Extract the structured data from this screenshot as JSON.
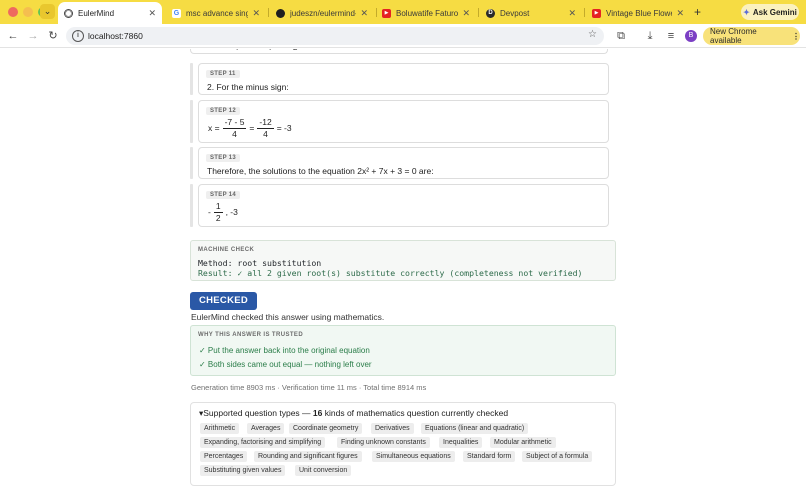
{
  "browser": {
    "tabs": [
      {
        "title": "EulerMind",
        "active": true,
        "icon": "globe-icon"
      },
      {
        "title": "msc advance single",
        "icon": "google-icon"
      },
      {
        "title": "judeszn/eulermind-v",
        "icon": "github-icon"
      },
      {
        "title": "Boluwatife Faturoti",
        "icon": "youtube-icon"
      },
      {
        "title": "Devpost",
        "icon": "devpost-icon"
      },
      {
        "title": "Vintage Blue Flowers",
        "icon": "youtube-icon"
      }
    ],
    "ask_gemini": "Ask Gemini",
    "url": "localhost:7860",
    "profile_initial": "B",
    "update_label": "New Chrome available"
  },
  "steps": [
    {
      "label": "STEP 11",
      "text": "2. For the minus sign:"
    },
    {
      "label": "STEP 12",
      "x_eq": "x =",
      "frac1_num": "-7 - 5",
      "frac1_den": "4",
      "eq2": "=",
      "frac2_num": "-12",
      "frac2_den": "4",
      "result": "= -3"
    },
    {
      "label": "STEP 13",
      "text": "Therefore, the solutions to the equation 2x² + 7x + 3 = 0 are:"
    },
    {
      "label": "STEP 14",
      "sign": "-",
      "frac_num": "1",
      "frac_den": "2",
      "rest": ", -3"
    }
  ],
  "clipped_fragment": {
    "a": "4",
    "b": "4",
    "c": "2"
  },
  "machine_check": {
    "title": "MACHINE CHECK",
    "method": "Method: root substitution",
    "result": "Result: ✓ all 2 given root(s) substitute correctly (completeness not verified)"
  },
  "verdict": {
    "badge": "CHECKED",
    "description": "EulerMind checked this answer using mathematics."
  },
  "trust": {
    "title": "WHY THIS ANSWER IS TRUSTED",
    "items": [
      "✓ Put the answer back into the original equation",
      "✓ Both sides came out equal — nothing left over"
    ]
  },
  "timing": "Generation time 8903 ms · Verification time 11 ms · Total time 8914 ms",
  "supported": {
    "prefix": "▾Supported question types — ",
    "count": "16",
    "suffix": " kinds of mathematics question currently checked",
    "types": [
      "Arithmetic",
      "Averages",
      "Coordinate geometry",
      "Derivatives",
      "Equations (linear and quadratic)",
      "Expanding, factorising and simplifying",
      "Finding unknown constants",
      "Inequalities",
      "Modular arithmetic",
      "Percentages",
      "Rounding and significant figures",
      "Simultaneous equations",
      "Standard form",
      "Subject of a formula",
      "Substituting given values",
      "Unit conversion"
    ]
  },
  "colors": {
    "tab_strip": "#f6dc43",
    "checked_badge": "#2a58a6",
    "trust_text": "#2a7d49",
    "result_text": "#2d6b4a"
  }
}
